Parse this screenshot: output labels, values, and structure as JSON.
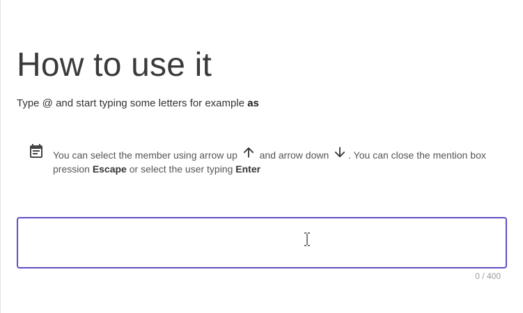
{
  "page": {
    "title": "How to use it",
    "subtitle_prefix": "Type @ and start typing some letters for example",
    "subtitle_example": "as"
  },
  "hint": {
    "icon": "calendar-note-icon",
    "text_1": "You can select the member using arrow up",
    "arrow_up_icon": "arrow-up-icon",
    "text_2": "and arrow down",
    "arrow_down_icon": "arrow-down-icon",
    "text_3": ". You can close the mention box pression",
    "key_escape": "Escape",
    "text_4": "or select the user typing",
    "key_enter": "Enter"
  },
  "input": {
    "value": "",
    "placeholder": "",
    "counter": "0 / 400",
    "border_color": "#5c4ec4"
  }
}
